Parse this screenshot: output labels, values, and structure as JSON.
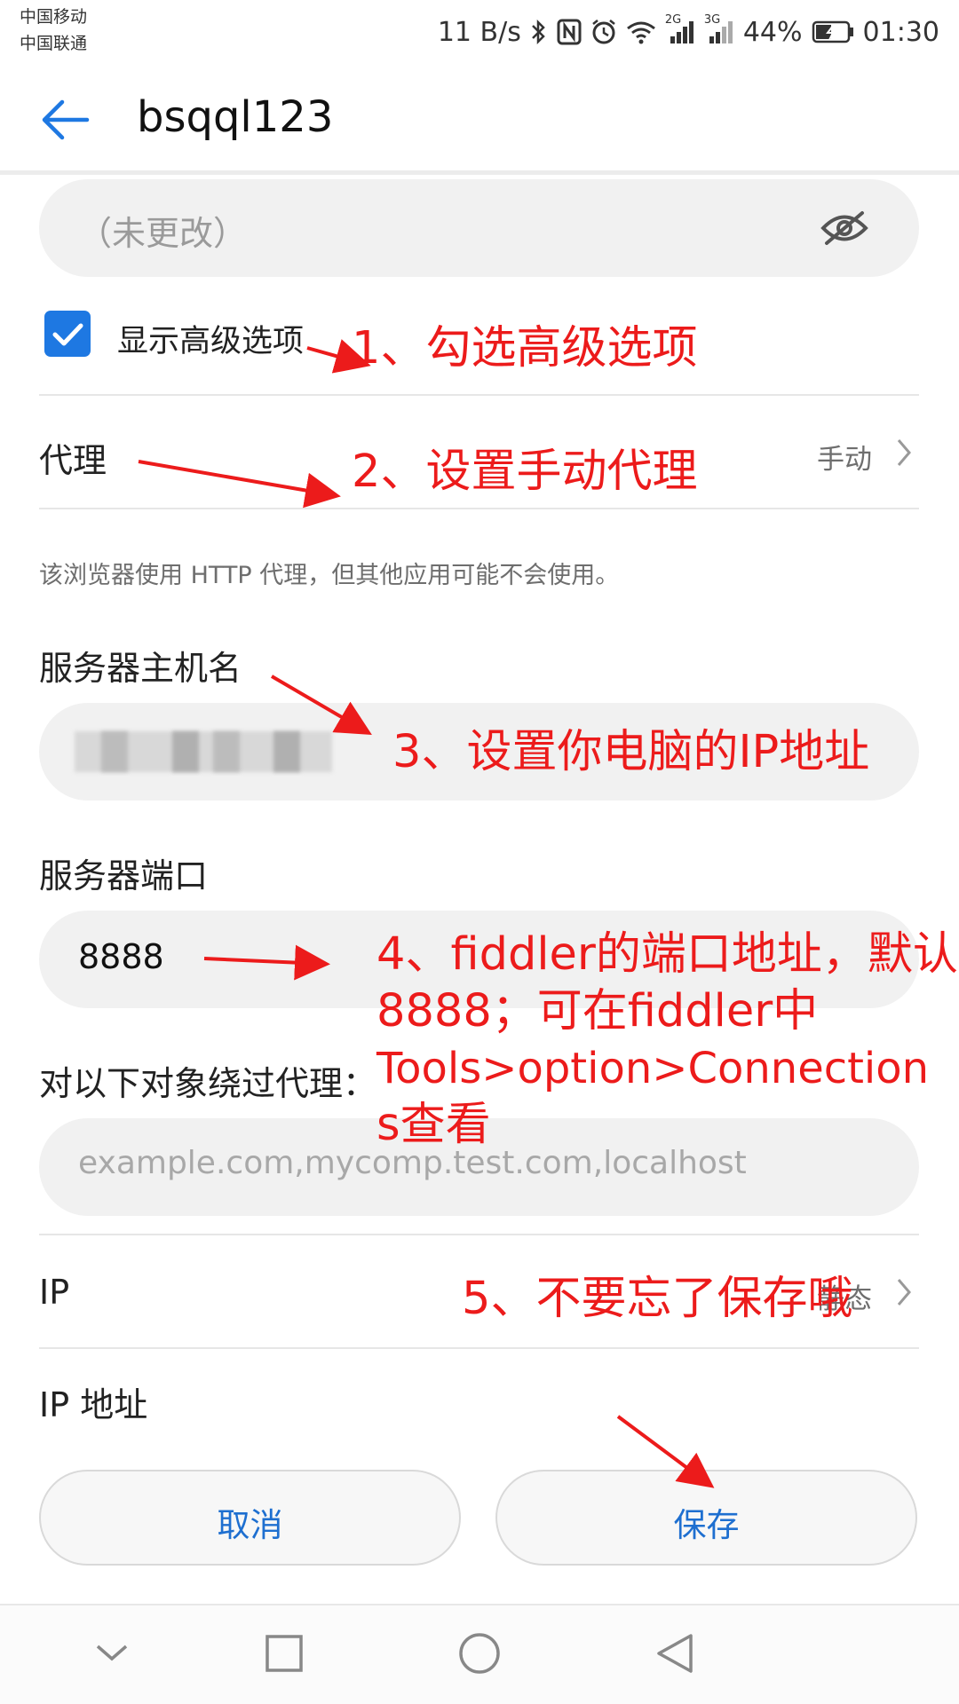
{
  "status_bar": {
    "carrier_1": "中国移动",
    "carrier_2": "中国联通",
    "net_speed": "11 B/s",
    "battery": "44%",
    "time": "01:30",
    "signal_2g": "2G",
    "signal_3g": "3G"
  },
  "app_bar": {
    "title": "bsqql123"
  },
  "password_field": {
    "placeholder": "（未更改）"
  },
  "advanced": {
    "label": "显示高级选项",
    "checked": true
  },
  "proxy": {
    "label": "代理",
    "value": "手动"
  },
  "proxy_hint": "该浏览器使用 HTTP 代理，但其他应用可能不会使用。",
  "hostname": {
    "label": "服务器主机名"
  },
  "port": {
    "label": "服务器端口",
    "value": "8888"
  },
  "bypass": {
    "label": "对以下对象绕过代理：",
    "placeholder": "example.com,mycomp.test.com,localhost"
  },
  "ip": {
    "label": "IP",
    "value": "静态"
  },
  "ip_address": {
    "label": "IP 地址"
  },
  "buttons": {
    "cancel": "取消",
    "save": "保存"
  },
  "annotations": {
    "a1": "1、勾选高级选项",
    "a2": "2、设置手动代理",
    "a3": "3、设置你电脑的IP地址",
    "a4_line1": "4、fiddler的端口地址，默认",
    "a4_line2": "8888；可在fiddler中",
    "a4_line3": "Tools>option>Connection",
    "a4_line4": "s查看",
    "a5": "5、不要忘了保存哦"
  },
  "colors": {
    "accent": "#1e78e2",
    "annotation": "#ec1b1b",
    "button_text": "#1e6fd0"
  }
}
